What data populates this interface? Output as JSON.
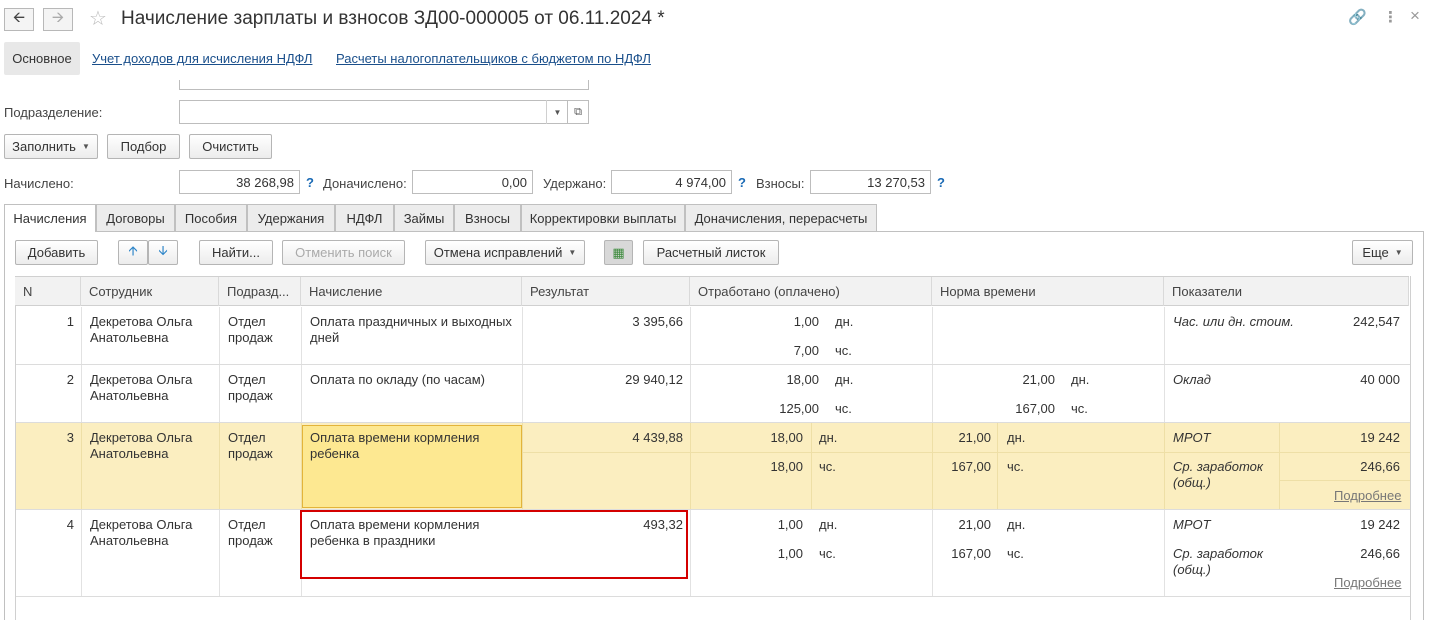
{
  "window": {
    "title": "Начисление зарплаты и взносов ЗД00-000005 от 06.11.2024 *"
  },
  "subnav": {
    "main": "Основное",
    "links": [
      "Учет доходов для исчисления НДФЛ",
      "Расчеты налогоплательщиков с бюджетом по НДФЛ"
    ]
  },
  "form": {
    "department_label": "Подразделение:",
    "department_value": "",
    "buttons": {
      "fill": "Заполнить",
      "pick": "Подбор",
      "clear": "Очистить"
    },
    "totals": {
      "accrued_label": "Начислено:",
      "accrued": "38 268,98",
      "extra_label": "Доначислено:",
      "extra": "0,00",
      "withheld_label": "Удержано:",
      "withheld": "4 974,00",
      "contrib_label": "Взносы:",
      "contrib": "13 270,53",
      "help": "?"
    }
  },
  "tabs": [
    "Начисления",
    "Договоры",
    "Пособия",
    "Удержания",
    "НДФЛ",
    "Займы",
    "Взносы",
    "Корректировки выплаты",
    "Доначисления, перерасчеты"
  ],
  "toolbar": {
    "add": "Добавить",
    "find": "Найти...",
    "cancel_search": "Отменить поиск",
    "cancel_fix": "Отмена исправлений",
    "payslip": "Расчетный листок",
    "more": "Еще"
  },
  "table": {
    "headers": [
      "N",
      "Сотрудник",
      "Подразд...",
      "Начисление",
      "Результат",
      "Отработано (оплачено)",
      "Норма времени",
      "Показатели"
    ],
    "more_link": "Подробнее",
    "rows": [
      {
        "n": "1",
        "employee": "Декретова Ольга Анатольевна",
        "dept": "Отдел продаж",
        "accrual": "Оплата праздничных и выходных дней",
        "result": "3 395,66",
        "worked_days": "1,00",
        "worked_days_unit": "дн.",
        "worked_hours": "7,00",
        "worked_hours_unit": "чс.",
        "norm_days": "",
        "norm_days_unit": "",
        "norm_hours": "",
        "norm_hours_unit": "",
        "ind1_name": "Час. или дн. стоим.",
        "ind1_value": "242,547",
        "ind2_name": "",
        "ind2_value": ""
      },
      {
        "n": "2",
        "employee": "Декретова Ольга Анатольевна",
        "dept": "Отдел продаж",
        "accrual": "Оплата по окладу (по часам)",
        "result": "29 940,12",
        "worked_days": "18,00",
        "worked_days_unit": "дн.",
        "worked_hours": "125,00",
        "worked_hours_unit": "чс.",
        "norm_days": "21,00",
        "norm_days_unit": "дн.",
        "norm_hours": "167,00",
        "norm_hours_unit": "чс.",
        "ind1_name": "Оклад",
        "ind1_value": "40 000",
        "ind2_name": "",
        "ind2_value": ""
      },
      {
        "n": "3",
        "employee": "Декретова Ольга Анатольевна",
        "dept": "Отдел продаж",
        "accrual": "Оплата времени кормления ребенка",
        "result": "4 439,88",
        "worked_days": "18,00",
        "worked_days_unit": "дн.",
        "worked_hours": "18,00",
        "worked_hours_unit": "чс.",
        "norm_days": "21,00",
        "norm_days_unit": "дн.",
        "norm_hours": "167,00",
        "norm_hours_unit": "чс.",
        "ind1_name": "МРОТ",
        "ind1_value": "19 242",
        "ind2_name": "Ср. заработок (общ.)",
        "ind2_value": "246,66"
      },
      {
        "n": "4",
        "employee": "Декретова Ольга Анатольевна",
        "dept": "Отдел продаж",
        "accrual": "Оплата времени кормления ребенка в праздники",
        "result": "493,32",
        "worked_days": "1,00",
        "worked_days_unit": "дн.",
        "worked_hours": "1,00",
        "worked_hours_unit": "чс.",
        "norm_days": "21,00",
        "norm_days_unit": "дн.",
        "norm_hours": "167,00",
        "norm_hours_unit": "чс.",
        "ind1_name": "МРОТ",
        "ind1_value": "19 242",
        "ind2_name": "Ср. заработок (общ.)",
        "ind2_value": "246,66"
      }
    ]
  }
}
